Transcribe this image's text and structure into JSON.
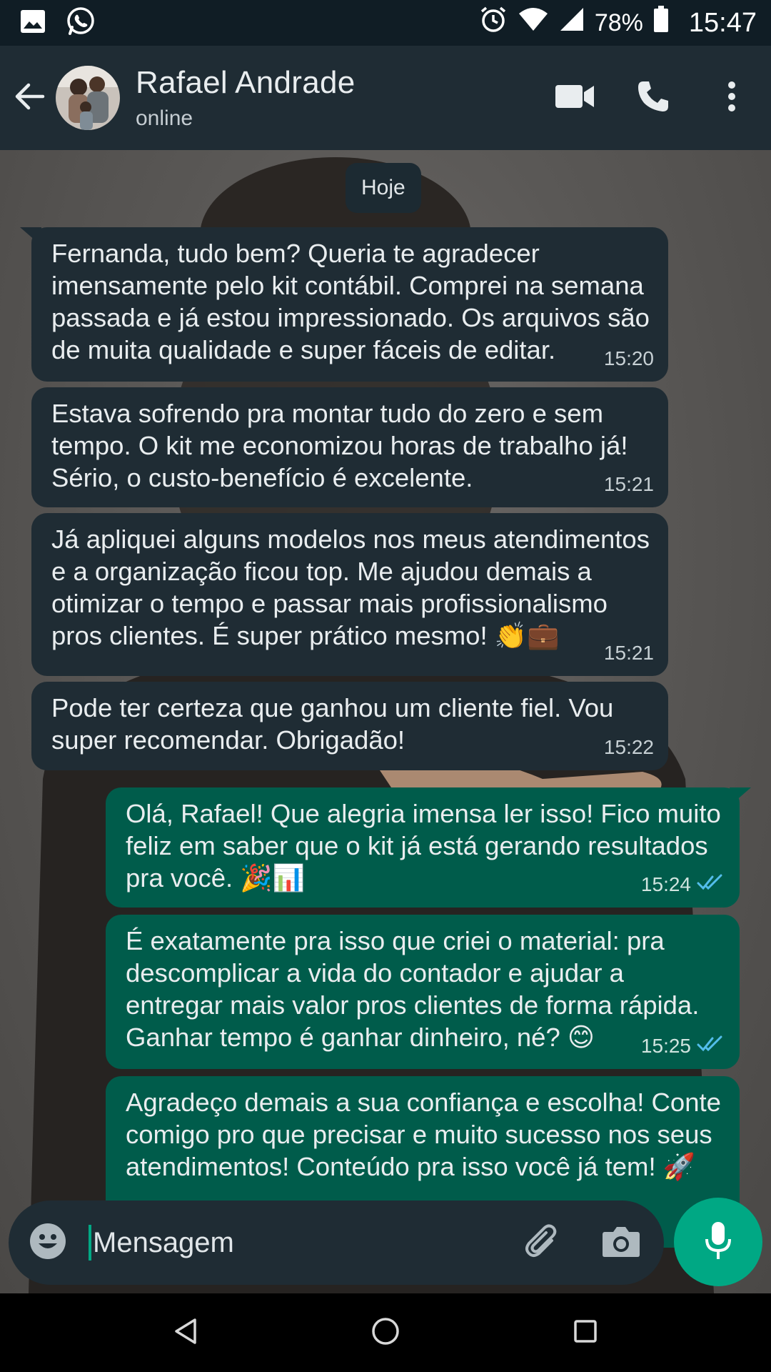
{
  "status_bar": {
    "battery_percent": "78%",
    "time": "15:47",
    "icons": [
      "gallery-icon",
      "whatsapp-icon",
      "alarm-icon",
      "wifi-icon",
      "signal-icon",
      "battery-icon"
    ]
  },
  "header": {
    "contact_name": "Rafael Andrade",
    "status": "online",
    "icons": [
      "back-arrow-icon",
      "video-call-icon",
      "voice-call-icon",
      "more-options-icon"
    ]
  },
  "chat": {
    "date_label": "Hoje",
    "messages": [
      {
        "direction": "in",
        "lines": [
          "Fernanda, tudo bem? Queria te agradecer",
          "imensamente pelo kit contábil. Comprei na semana",
          "passada e já estou impressionado. Os arquivos são",
          "de muita qualidade e super fáceis de editar."
        ],
        "time": "15:20"
      },
      {
        "direction": "in",
        "lines": [
          "Estava sofrendo pra montar tudo do zero e sem",
          "tempo. O kit me economizou horas de trabalho já!",
          "Sério, o custo-benefício é excelente."
        ],
        "time": "15:21"
      },
      {
        "direction": "in",
        "lines": [
          "Já apliquei alguns modelos nos meus atendimentos",
          "e a organização ficou top. Me ajudou demais a",
          "otimizar o tempo e passar mais profissionalismo",
          "pros clientes. É super prático mesmo! 👏💼"
        ],
        "time": "15:21"
      },
      {
        "direction": "in",
        "lines": [
          "Pode ter certeza que ganhou um cliente fiel. Vou",
          "super recomendar. Obrigadão!"
        ],
        "time": "15:22"
      },
      {
        "direction": "out",
        "lines": [
          "Olá, Rafael! Que alegria imensa ler isso! Fico muito",
          "feliz em saber que o kit já está gerando resultados",
          "pra você. 🎉📊"
        ],
        "time": "15:24",
        "read": true
      },
      {
        "direction": "out",
        "lines": [
          "É exatamente pra isso que criei o material: pra",
          "descomplicar a vida do contador e ajudar a",
          "entregar mais valor pros clientes de forma rápida.",
          "Ganhar tempo é ganhar dinheiro, né? 😊"
        ],
        "time": "15:25",
        "read": true
      },
      {
        "direction": "out",
        "lines": [
          "Agradeço demais a sua confiança e escolha! Conte",
          "comigo pro que precisar e muito sucesso nos seus",
          "atendimentos! Conteúdo pra isso você já tem! 🚀"
        ]
      }
    ]
  },
  "input": {
    "placeholder": "Mensagem",
    "icons": [
      "emoji-icon",
      "attach-icon",
      "camera-icon",
      "mic-icon"
    ]
  },
  "navbar": {
    "icons": [
      "nav-back-icon",
      "nav-home-icon",
      "nav-recents-icon"
    ]
  },
  "colors": {
    "header": "#1f2c34",
    "incoming_bubble": "#1f2c34",
    "outgoing_bubble": "#005c4b",
    "accent": "#00a884",
    "read_ticks": "#53bdeb"
  }
}
